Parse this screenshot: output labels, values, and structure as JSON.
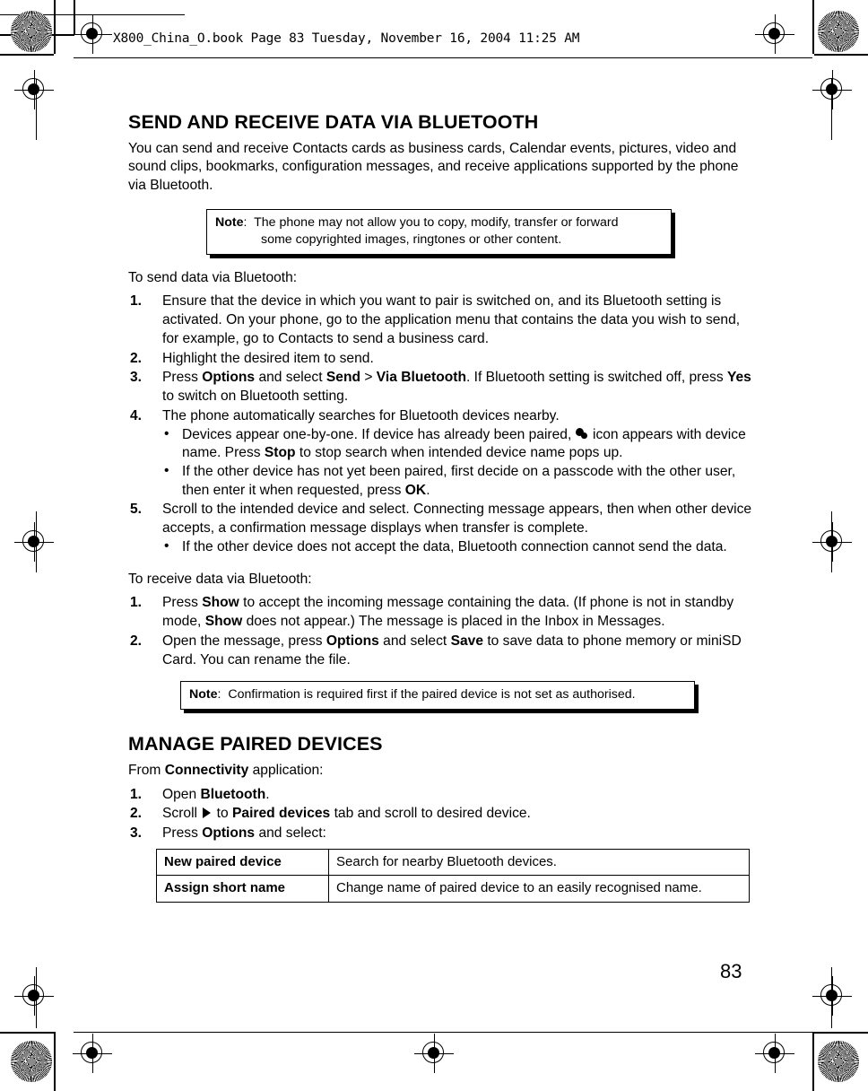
{
  "header": {
    "print_info": "X800_China_O.book  Page 83  Tuesday, November 16, 2004  11:25 AM"
  },
  "page_number": "83",
  "sections": [
    {
      "title": "SEND AND RECEIVE DATA VIA BLUETOOTH",
      "intro": "You can send and receive Contacts cards as business cards, Calendar events, pictures, video and sound clips, bookmarks, configuration messages, and receive applications supported by the phone via Bluetooth."
    },
    {
      "title": "MANAGE PAIRED DEVICES"
    }
  ],
  "note1": {
    "label": "Note",
    "separator": ":",
    "line1": "The phone may not allow you to copy, modify, transfer or forward",
    "line2": "some copyrighted images, ringtones or other content."
  },
  "note2": {
    "label": "Note",
    "separator": ":",
    "line1": "Confirmation is required first if the paired device is not set as authorised."
  },
  "send_section": {
    "lead_in": "To send data via Bluetooth:",
    "steps": [
      {
        "num": "1.",
        "text": "Ensure that the device in which you want to pair is switched on, and its Bluetooth setting is activated. On your phone, go to the application menu that contains the data you wish to send, for example, go to Contacts to send a business card."
      },
      {
        "num": "2.",
        "text": "Highlight the desired item to send."
      },
      {
        "num": "3.",
        "parts": [
          {
            "t": "Press ",
            "bold": false
          },
          {
            "t": "Options",
            "bold": true
          },
          {
            "t": " and select ",
            "bold": false
          },
          {
            "t": "Send",
            "bold": true
          },
          {
            "t": " > ",
            "bold": false
          },
          {
            "t": "Via Bluetooth",
            "bold": true
          },
          {
            "t": ". If Bluetooth setting is switched off, press ",
            "bold": false
          },
          {
            "t": "Yes",
            "bold": true
          },
          {
            "t": " to switch on Bluetooth setting.",
            "bold": false
          }
        ]
      },
      {
        "num": "4.",
        "text": "The phone automatically searches for Bluetooth devices nearby.",
        "sub": [
          {
            "bullet": "•",
            "parts": [
              {
                "t": "Devices appear one-by-one. If device has already been paired, ",
                "bold": false
              },
              {
                "icon": "paired-devices-icon"
              },
              {
                "t": " icon appears with device name. Press ",
                "bold": false
              },
              {
                "t": "Stop",
                "bold": true
              },
              {
                "t": " to stop search when intended device name pops up.",
                "bold": false
              }
            ]
          },
          {
            "bullet": "•",
            "parts": [
              {
                "t": "If the other device has not yet been paired, first decide on a passcode with the other user, then enter it when requested, press ",
                "bold": false
              },
              {
                "t": "OK",
                "bold": true
              },
              {
                "t": ".",
                "bold": false
              }
            ]
          }
        ]
      },
      {
        "num": "5.",
        "text": "Scroll to the intended device and select. Connecting message appears, then when other device accepts, a confirmation message displays when transfer is complete.",
        "sub": [
          {
            "bullet": "•",
            "parts": [
              {
                "t": "If the other device does not accept the data, Bluetooth connection cannot send the data.",
                "bold": false
              }
            ]
          }
        ]
      }
    ]
  },
  "receive_section": {
    "lead_in": "To receive data via Bluetooth:",
    "steps": [
      {
        "num": "1.",
        "parts": [
          {
            "t": "Press ",
            "bold": false
          },
          {
            "t": "Show",
            "bold": true
          },
          {
            "t": " to accept the incoming message containing the data. (If phone is not in standby mode, ",
            "bold": false
          },
          {
            "t": "Show",
            "bold": true
          },
          {
            "t": " does not appear.) The message is placed in the Inbox in Messages.",
            "bold": false
          }
        ]
      },
      {
        "num": "2.",
        "parts": [
          {
            "t": "Open the message, press ",
            "bold": false
          },
          {
            "t": "Options",
            "bold": true
          },
          {
            "t": " and select ",
            "bold": false
          },
          {
            "t": "Save",
            "bold": true
          },
          {
            "t": " to save data to phone memory or miniSD Card. You can rename the file.",
            "bold": false
          }
        ]
      }
    ]
  },
  "manage_section": {
    "lead_in_parts": [
      {
        "t": "From ",
        "bold": false
      },
      {
        "t": "Connectivity",
        "bold": true
      },
      {
        "t": " application:",
        "bold": false
      }
    ],
    "steps": [
      {
        "num": "1.",
        "parts": [
          {
            "t": "Open ",
            "bold": false
          },
          {
            "t": "Bluetooth",
            "bold": true
          },
          {
            "t": ".",
            "bold": false
          }
        ]
      },
      {
        "num": "2.",
        "parts": [
          {
            "t": "Scroll ",
            "bold": false
          },
          {
            "icon": "arrow-right-icon"
          },
          {
            "t": " to ",
            "bold": false
          },
          {
            "t": "Paired devices",
            "bold": true
          },
          {
            "t": " tab and scroll to desired device.",
            "bold": false
          }
        ]
      },
      {
        "num": "3.",
        "parts": [
          {
            "t": "Press ",
            "bold": false
          },
          {
            "t": "Options",
            "bold": true
          },
          {
            "t": " and select:",
            "bold": false
          }
        ]
      }
    ],
    "options_table": {
      "rows": [
        {
          "key": "New paired device",
          "value": "Search for nearby Bluetooth devices."
        },
        {
          "key": "Assign short name",
          "value": "Change name of paired device to an easily recognised name."
        }
      ]
    }
  }
}
